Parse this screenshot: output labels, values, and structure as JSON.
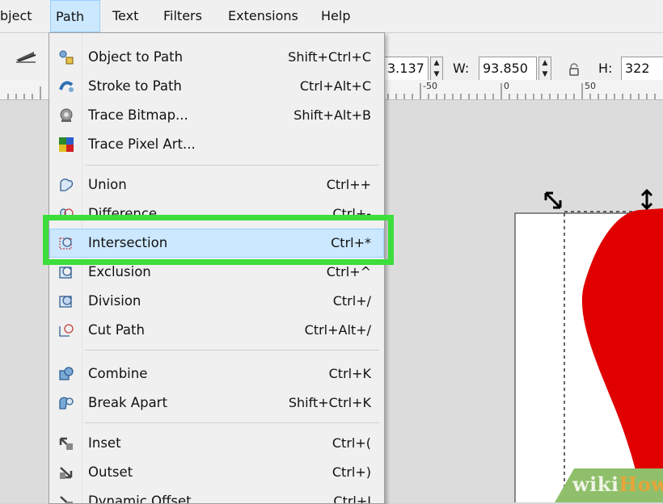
{
  "menubar": {
    "items": [
      {
        "label": "bject",
        "active": false
      },
      {
        "label": "Path",
        "active": true
      },
      {
        "label": "Text",
        "active": false
      },
      {
        "label": "Filters",
        "active": false
      },
      {
        "label": "Extensions",
        "active": false
      },
      {
        "label": "Help",
        "active": false
      }
    ]
  },
  "toolbar": {
    "x_value": "3.137",
    "w_label": "W:",
    "w_value": "93.850",
    "h_label": "H:",
    "h_value": "322"
  },
  "ruler": {
    "labels": [
      "-50",
      "0",
      "50"
    ]
  },
  "path_menu": {
    "items": [
      {
        "label": "Object to Path",
        "shortcut": "Shift+Ctrl+C",
        "icon": "object-to-path-icon"
      },
      {
        "label": "Stroke to Path",
        "shortcut": "Ctrl+Alt+C",
        "icon": "stroke-to-path-icon"
      },
      {
        "label": "Trace Bitmap...",
        "shortcut": "Shift+Alt+B",
        "icon": "trace-bitmap-icon"
      },
      {
        "label": "Trace Pixel Art...",
        "shortcut": "",
        "icon": "trace-pixel-art-icon"
      },
      {
        "label": "Union",
        "shortcut": "Ctrl++",
        "icon": "union-icon"
      },
      {
        "label": "Difference",
        "shortcut": "Ctrl+-",
        "icon": "difference-icon"
      },
      {
        "label": "Intersection",
        "shortcut": "Ctrl+*",
        "icon": "intersection-icon",
        "highlighted": true
      },
      {
        "label": "Exclusion",
        "shortcut": "Ctrl+^",
        "icon": "exclusion-icon"
      },
      {
        "label": "Division",
        "shortcut": "Ctrl+/",
        "icon": "division-icon"
      },
      {
        "label": "Cut Path",
        "shortcut": "Ctrl+Alt+/",
        "icon": "cut-path-icon"
      },
      {
        "label": "Combine",
        "shortcut": "Ctrl+K",
        "icon": "combine-icon"
      },
      {
        "label": "Break Apart",
        "shortcut": "Shift+Ctrl+K",
        "icon": "break-apart-icon"
      },
      {
        "label": "Inset",
        "shortcut": "Ctrl+(",
        "icon": "inset-icon"
      },
      {
        "label": "Outset",
        "shortcut": "Ctrl+)",
        "icon": "outset-icon"
      },
      {
        "label": "Dynamic Offset",
        "shortcut": "Ctrl+J",
        "icon": "dynamic-offset-icon"
      }
    ]
  },
  "watermark": {
    "wiki": "wiki",
    "how": "How"
  },
  "colors": {
    "highlight_box": "#3cde3c",
    "shape_fill": "#e00000",
    "menu_highlight": "#cce8ff"
  }
}
